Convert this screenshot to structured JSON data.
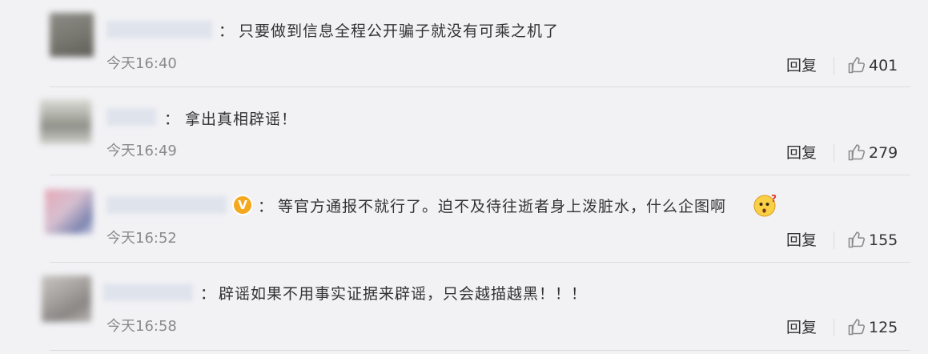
{
  "comments": [
    {
      "colon": "：",
      "text": "只要做到信息全程公开骗子就没有可乘之机了",
      "time": "今天16:40",
      "reply_label": "回复",
      "likes": "401",
      "verified": false,
      "has_emoji": false
    },
    {
      "colon": "：",
      "text": "拿出真相辟谣！",
      "time": "今天16:49",
      "reply_label": "回复",
      "likes": "279",
      "verified": false,
      "has_emoji": false
    },
    {
      "colon": "：",
      "text": "等官方通报不就行了。迫不及待往逝者身上泼脏水，什么企图啊",
      "time": "今天16:52",
      "reply_label": "回复",
      "likes": "155",
      "verified": true,
      "verified_badge": "V",
      "has_emoji": true,
      "emoji_icon": "puzzled-face-icon"
    },
    {
      "colon": "：",
      "text": "辟谣如果不用事实证据来辟谣，只会越描越黑！！！",
      "time": "今天16:58",
      "reply_label": "回复",
      "likes": "125",
      "verified": false,
      "has_emoji": false
    }
  ],
  "colors": {
    "background": "#f2f2f5",
    "text": "#333333",
    "time": "#8a8a8a",
    "divider": "#dcdcdc",
    "verified_badge": "#f4a81d"
  }
}
